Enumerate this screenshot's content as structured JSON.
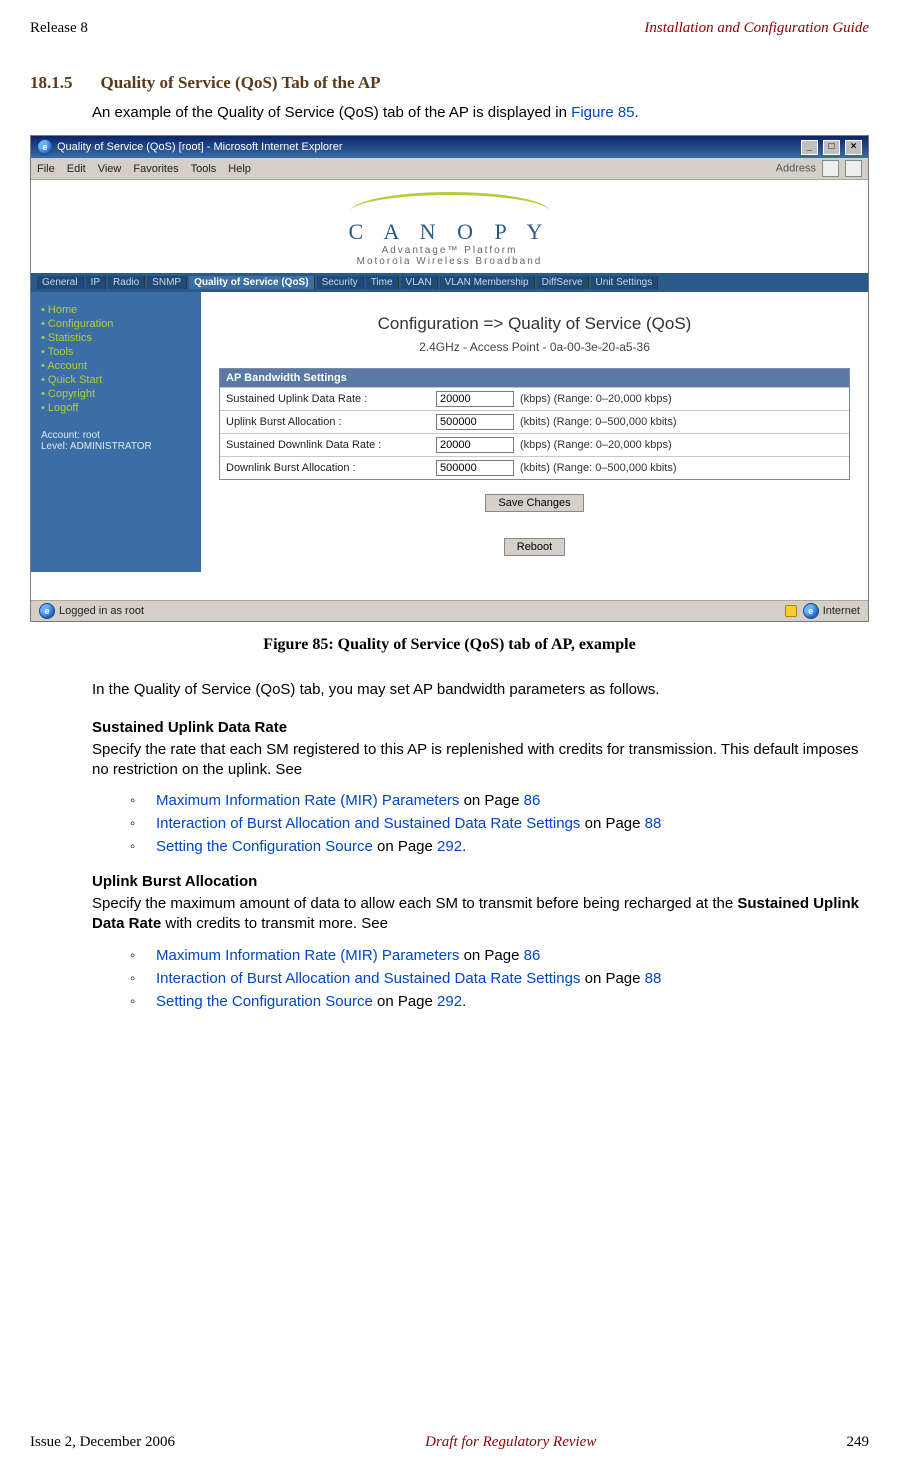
{
  "header": {
    "left": "Release 8",
    "right": "Installation and Configuration Guide"
  },
  "section": {
    "number": "18.1.5",
    "title": "Quality of Service (QoS) Tab of the AP",
    "intro_pre": "An example of the Quality of Service (QoS) tab of the AP is displayed in ",
    "intro_link": "Figure 85",
    "intro_post": "."
  },
  "figure": {
    "caption": "Figure 85: Quality of Service (QoS) tab of AP, example"
  },
  "browser": {
    "title": "Quality of Service (QoS) [root] - Microsoft Internet Explorer",
    "menu": [
      "File",
      "Edit",
      "View",
      "Favorites",
      "Tools",
      "Help"
    ],
    "address_label": "Address",
    "logo": "C A N O P Y",
    "logo_sub": "Advantage™ Platform",
    "logo_sub2": "Motorola Wireless Broadband",
    "tabs": [
      "General",
      "IP",
      "Radio",
      "SNMP",
      "Quality of Service (QoS)",
      "Security",
      "Time",
      "VLAN",
      "VLAN Membership",
      "DiffServe",
      "Unit Settings"
    ],
    "active_tab_index": 4,
    "sidebar": {
      "items": [
        "Home",
        "Configuration",
        "Statistics",
        "Tools",
        "Account",
        "Quick Start",
        "Copyright",
        "Logoff"
      ],
      "account_line1": "Account: root",
      "account_line2": "Level: ADMINISTRATOR"
    },
    "crumb": "Configuration => Quality of Service (QoS)",
    "device": "2.4GHz - Access Point - 0a-00-3e-20-a5-36",
    "panel_title": "AP Bandwidth Settings",
    "rows": [
      {
        "label": "Sustained Uplink Data Rate :",
        "value": "20000",
        "hint": "(kbps) (Range: 0–20,000 kbps)"
      },
      {
        "label": "Uplink Burst Allocation :",
        "value": "500000",
        "hint": "(kbits) (Range: 0–500,000 kbits)"
      },
      {
        "label": "Sustained Downlink Data Rate :",
        "value": "20000",
        "hint": "(kbps) (Range: 0–20,000 kbps)"
      },
      {
        "label": "Downlink Burst Allocation :",
        "value": "500000",
        "hint": "(kbits) (Range: 0–500,000 kbits)"
      }
    ],
    "save_btn": "Save Changes",
    "reboot_btn": "Reboot",
    "status_left": "Logged in as root",
    "status_right": "Internet"
  },
  "para_after_fig": "In the Quality of Service (QoS) tab, you may set AP bandwidth parameters as follows.",
  "sudr": {
    "heading": "Sustained Uplink Data Rate",
    "text": "Specify the rate that each SM registered to this AP is replenished with credits for transmission. This default imposes no restriction on the uplink. See",
    "links": [
      {
        "text": "Maximum Information Rate (MIR) Parameters",
        "suffix": " on Page ",
        "page": "86"
      },
      {
        "text": "Interaction of Burst Allocation and Sustained Data Rate Settings",
        "suffix": " on Page ",
        "page": "88"
      },
      {
        "text": "Setting the Configuration Source",
        "suffix": " on Page ",
        "page": "292",
        "tail": "."
      }
    ]
  },
  "uba": {
    "heading": "Uplink Burst Allocation",
    "text_pre": "Specify the maximum amount of data to allow each SM to transmit before being recharged at the ",
    "text_bold": "Sustained Uplink Data Rate",
    "text_post": " with credits to transmit more. See",
    "links": [
      {
        "text": "Maximum Information Rate (MIR) Parameters",
        "suffix": " on Page ",
        "page": "86"
      },
      {
        "text": "Interaction of Burst Allocation and Sustained Data Rate Settings",
        "suffix": " on Page ",
        "page": "88"
      },
      {
        "text": "Setting the Configuration Source",
        "suffix": " on Page ",
        "page": "292",
        "tail": "."
      }
    ]
  },
  "footer": {
    "left": "Issue 2, December 2006",
    "mid": "Draft for Regulatory Review",
    "right": "249"
  }
}
